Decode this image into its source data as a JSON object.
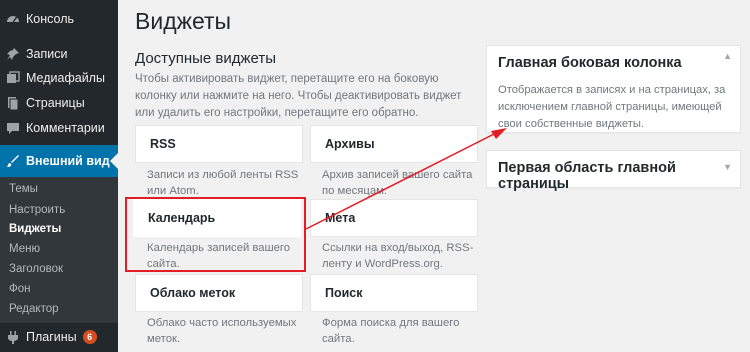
{
  "sidebar": {
    "items": [
      {
        "label": "Консоль",
        "icon": "dashboard-icon"
      },
      {
        "label": "Записи",
        "icon": "pin-icon"
      },
      {
        "label": "Медиафайлы",
        "icon": "media-icon"
      },
      {
        "label": "Страницы",
        "icon": "page-icon"
      },
      {
        "label": "Комментарии",
        "icon": "comment-icon"
      },
      {
        "label": "Внешний вид",
        "icon": "brush-icon"
      }
    ],
    "submenu": [
      "Темы",
      "Настроить",
      "Виджеты",
      "Меню",
      "Заголовок",
      "Фон",
      "Редактор"
    ],
    "plugins": {
      "label": "Плагины",
      "badge": "6",
      "icon": "plugin-icon"
    }
  },
  "main": {
    "title": "Виджеты",
    "available": {
      "title": "Доступные виджеты",
      "description": "Чтобы активировать виджет, перетащите его на боковую колонку или нажмите на него. Чтобы деактивировать виджет или удалить его настройки, перетащите его обратно."
    },
    "widgets": [
      {
        "title": "RSS",
        "description": "Записи из любой ленты RSS или Atom."
      },
      {
        "title": "Архивы",
        "description": "Архив записей вашего сайта по месяцам."
      },
      {
        "title": "Календарь",
        "description": "Календарь записей вашего сайта."
      },
      {
        "title": "Мета",
        "description": "Ссылки на вход/выход, RSS-ленту и WordPress.org."
      },
      {
        "title": "Облако меток",
        "description": "Облако часто используемых меток."
      },
      {
        "title": "Поиск",
        "description": "Форма поиска для вашего сайта."
      }
    ]
  },
  "areas": [
    {
      "title": "Главная боковая колонка",
      "description": "Отображается в записях и на страницах, за исключением главной страницы, имеющей свои собственные виджеты.",
      "arrow": "▲"
    },
    {
      "title": "Первая область главной страницы",
      "arrow": "▼"
    }
  ],
  "colors": {
    "sidebar": "#23282d",
    "active": "#0073aa",
    "annotation": "#e21d24",
    "badge": "#d54e21"
  }
}
